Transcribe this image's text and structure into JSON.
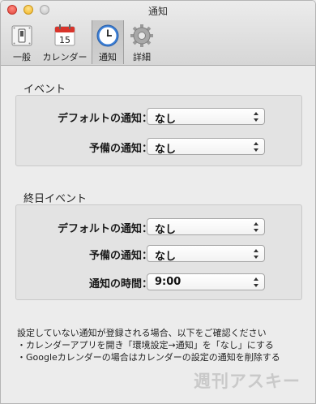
{
  "window": {
    "title": "通知"
  },
  "toolbar": {
    "items": [
      {
        "label": "一般",
        "icon": "switch-icon"
      },
      {
        "label": "カレンダー",
        "icon": "calendar-icon",
        "date": "15"
      },
      {
        "label": "通知",
        "icon": "clock-icon",
        "selected": true
      },
      {
        "label": "詳細",
        "icon": "gear-icon"
      }
    ]
  },
  "event": {
    "title": "イベント",
    "rows": [
      {
        "label": "デフォルトの通知：",
        "value": "なし"
      },
      {
        "label": "予備の通知：",
        "value": "なし"
      }
    ]
  },
  "allday": {
    "title": "終日イベント",
    "rows": [
      {
        "label": "デフォルトの通知：",
        "value": "なし"
      },
      {
        "label": "予備の通知：",
        "value": "なし"
      },
      {
        "label": "通知の時間：",
        "value": "9:00"
      }
    ]
  },
  "notes": [
    "設定していない通知が登録される場合、以下をご確認ください",
    "・カレンダーアプリを開き「環境設定→通知」を「なし」にする",
    "・Googleカレンダーの場合はカレンダーの設定の通知を削除する"
  ],
  "watermark": "週刊アスキー",
  "colors": {
    "window_bg": "#ececec",
    "box_bg": "#e3e3e3",
    "calendar_red": "#d9342b",
    "clock_blue": "#3b7fd6"
  }
}
